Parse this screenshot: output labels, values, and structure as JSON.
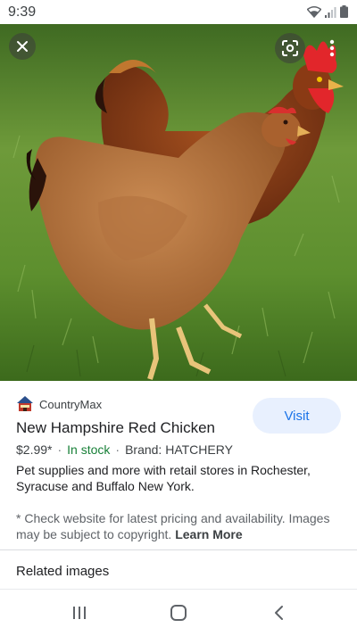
{
  "status_bar": {
    "time": "9:39"
  },
  "product": {
    "source": "CountryMax",
    "title": "New Hampshire Red Chicken",
    "price": "$2.99*",
    "stock": "In stock",
    "brand": "Brand: HATCHERY",
    "description": "Pet supplies and more with retail stores in Rochester, Syracuse and Buffalo New York.",
    "disclaimer": "* Check website for latest pricing and availability. Images may be subject to copyright.",
    "learn_more": "Learn More",
    "visit_label": "Visit"
  },
  "related_label": "Related images",
  "icons": {
    "close": "close-icon",
    "lens": "lens-icon",
    "more": "more-vert-icon",
    "recents": "recents-icon",
    "home": "home-icon",
    "back": "back-icon"
  },
  "colors": {
    "accent": "#1a73e8",
    "visit_bg": "#e8f0fe",
    "in_stock": "#188038"
  }
}
